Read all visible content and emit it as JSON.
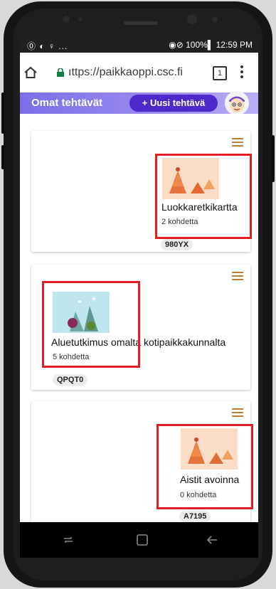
{
  "status": {
    "left_icons": "⓪ ◐ ♀ ...",
    "right": "◉⊘ 100%▌ 12:59 PM"
  },
  "browser": {
    "url": "ıttps://paikkaoppi.csc.fi",
    "tab_count": "1"
  },
  "appbar": {
    "title": "Omat tehtävät",
    "new_button": "+ Uusi tehtävä"
  },
  "cards": [
    {
      "title": "Luokkaretkikartta",
      "subtitle": "2 kohdetta",
      "code": "980YX"
    },
    {
      "title": "Aluetutkimus omalta kotipaikkakunnalta",
      "subtitle": "5 kohdetta",
      "code": "QPQT0"
    },
    {
      "title": "Aistit avoinna",
      "subtitle": "0 kohdetta",
      "code": "A7195"
    }
  ],
  "colors": {
    "accent": "#4e28c9",
    "appbar": "#8b7cee",
    "highlight": "#e31e24",
    "menu_icon": "#c07c3d"
  }
}
